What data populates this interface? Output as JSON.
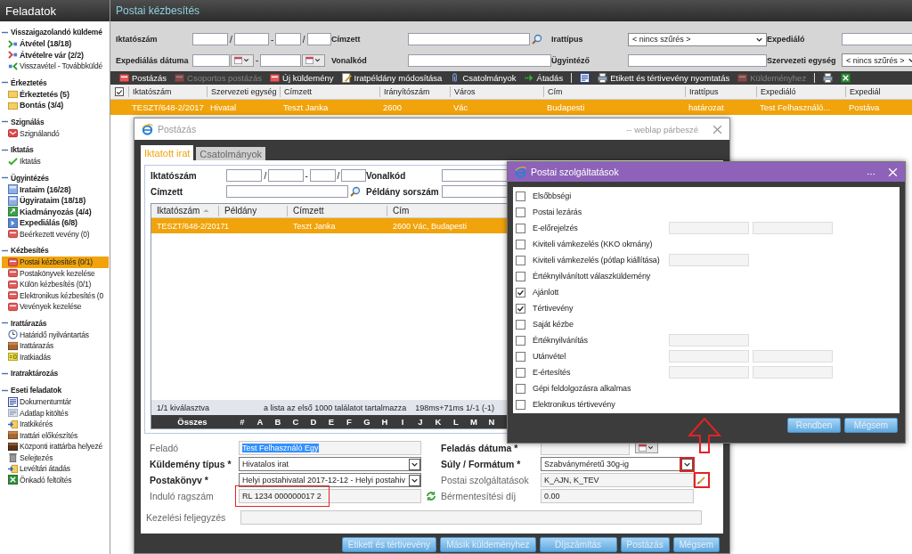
{
  "sidebar": {
    "title": "Feladatok",
    "groups": [
      {
        "label": "Visszaigazolandó küldemé",
        "expanded": true,
        "items": [
          {
            "label": "Átvétel (18/18)",
            "kind": "chevron-green",
            "bold": true,
            "selected": false
          },
          {
            "label": "Átvételre vár (2/2)",
            "kind": "chevron-red",
            "bold": true,
            "selected": false
          },
          {
            "label": "Visszavétel - Továbbküldé",
            "kind": "chevron-back",
            "bold": false,
            "selected": false
          }
        ]
      },
      {
        "label": "Érkeztetés",
        "expanded": true,
        "items": [
          {
            "label": "Érkeztetés (5)",
            "kind": "folder",
            "bold": true,
            "selected": false
          },
          {
            "label": "Bontás (3/4)",
            "kind": "folder",
            "bold": true,
            "selected": false
          }
        ]
      },
      {
        "label": "Szignálás",
        "expanded": true,
        "items": [
          {
            "label": "Szignálandó",
            "kind": "envelope",
            "bold": false,
            "selected": false
          }
        ]
      },
      {
        "label": "Iktatás",
        "expanded": true,
        "items": [
          {
            "label": "Iktatás",
            "kind": "check",
            "bold": false,
            "selected": false
          }
        ]
      },
      {
        "label": "Ügyintézés",
        "expanded": true,
        "items": [
          {
            "label": "Irataim (16/28)",
            "kind": "doc-blue",
            "bold": true,
            "selected": false
          },
          {
            "label": "Ügyirataim (18/18)",
            "kind": "doc-blue",
            "bold": true,
            "selected": false
          },
          {
            "label": "Kiadmányozás (4/4)",
            "kind": "doc-green",
            "bold": true,
            "selected": false
          },
          {
            "label": "Expediálás (6/8)",
            "kind": "doc-send",
            "bold": true,
            "selected": false
          },
          {
            "label": "Beérkezett vevény (0)",
            "kind": "red-box",
            "bold": false,
            "selected": false
          }
        ]
      },
      {
        "label": "Kézbesítés",
        "expanded": true,
        "items": [
          {
            "label": "Postai kézbesítés (0/1)",
            "kind": "red-box",
            "bold": false,
            "selected": true
          },
          {
            "label": "Postakönyvek kezelése",
            "kind": "red-box",
            "bold": false,
            "selected": false
          },
          {
            "label": "Külön kézbesítés (0/1)",
            "kind": "red-box",
            "bold": false,
            "selected": false
          },
          {
            "label": "Elektronikus kézbesítés (0",
            "kind": "red-box",
            "bold": false,
            "selected": false
          },
          {
            "label": "Vevények kezelése",
            "kind": "red-box",
            "bold": false,
            "selected": false
          }
        ]
      },
      {
        "label": "Irattárazás",
        "expanded": true,
        "items": [
          {
            "label": "Határidő nyilvántartás",
            "kind": "clock",
            "bold": false,
            "selected": false
          },
          {
            "label": "Irattárazás",
            "kind": "brown-box",
            "bold": false,
            "selected": false
          },
          {
            "label": "Iratkiadás",
            "kind": "yellow-card",
            "bold": false,
            "selected": false
          }
        ]
      },
      {
        "label": "Iratraktározás",
        "expanded": true
      },
      {
        "label": "Eseti feladatok",
        "expanded": true,
        "items": [
          {
            "label": "Dokumentumtár",
            "kind": "word",
            "bold": false,
            "selected": false
          },
          {
            "label": "Adatlap kitöltés",
            "kind": "form",
            "bold": false,
            "selected": false
          },
          {
            "label": "Iratkikérés",
            "kind": "arrow-yellow",
            "bold": false,
            "selected": false
          },
          {
            "label": "Irattári előkészítés",
            "kind": "brown-box",
            "bold": false,
            "selected": false
          },
          {
            "label": "Központi irattárba helyezé",
            "kind": "dark-box",
            "bold": false,
            "selected": false
          },
          {
            "label": "Selejtezés",
            "kind": "trash",
            "bold": false,
            "selected": false
          },
          {
            "label": "Levéltári átadás",
            "kind": "arrow-yellow",
            "bold": false,
            "selected": false
          },
          {
            "label": "Önkadó feltöltés",
            "kind": "excel",
            "bold": false,
            "selected": false
          }
        ]
      }
    ]
  },
  "main": {
    "title": "Postai kézbesítés",
    "filters": [
      {
        "label": "Iktatószám",
        "kind": "number",
        "separators": [
          "/",
          "-",
          "/"
        ]
      },
      {
        "label": "Címzett",
        "kind": "search"
      },
      {
        "label": "Irattípus",
        "kind": "select",
        "value": "< nincs szűrés >"
      },
      {
        "label": "Expediáló",
        "kind": "text"
      },
      {
        "label": "Expediálás dátuma",
        "kind": "daterange",
        "separator": "-"
      },
      {
        "label": "Vonalkód",
        "kind": "text"
      },
      {
        "label": "Ügyintéző",
        "kind": "text"
      },
      {
        "label": "Szervezeti egység",
        "kind": "select",
        "value": "< nincs szűrés >"
      }
    ],
    "toolbar": [
      {
        "label": "Postázás",
        "kind": "red-doc",
        "disabled": false
      },
      {
        "label": "Csoportos postázás",
        "kind": "red-doc",
        "disabled": true
      },
      {
        "label": "Új küldemény",
        "kind": "red-doc",
        "disabled": false
      },
      {
        "label": "Iratpéldány módosítása",
        "kind": "edit",
        "disabled": false
      },
      {
        "label": "Csatolmányok",
        "kind": "clip",
        "disabled": false
      },
      {
        "label": "Átadás",
        "kind": "forward",
        "disabled": false
      },
      {
        "kind": "separator"
      },
      {
        "kind": "word",
        "disabled": false
      },
      {
        "label": "Etikett és tértivevény nyomtatás",
        "kind": "print",
        "disabled": false
      },
      {
        "label": "Küldeményhez",
        "kind": "red-doc",
        "disabled": true
      },
      {
        "kind": "separator"
      },
      {
        "kind": "print",
        "disabled": false
      },
      {
        "kind": "excel",
        "disabled": false
      }
    ],
    "table": {
      "checked": true,
      "columns": [
        "Iktatószám",
        "Szervezeti egység",
        "Címzett",
        "Irányítószám",
        "Város",
        "Cím",
        "Irattípus",
        "Expediáló",
        "Expediál"
      ],
      "rows": [
        {
          "selected": true,
          "cells": [
            "TESZT/648-2/2017",
            "Hivatal",
            "Teszt Janka",
            "2600",
            "Vác",
            "Budapesti",
            "határozat",
            "Test Felhasználó...",
            "Postáva"
          ]
        }
      ]
    }
  },
  "postazas": {
    "title": "Postázás",
    "subtitle": "-- weblap párbeszé",
    "tabs": [
      {
        "label": "Iktatott irat",
        "selected": true
      },
      {
        "label": "Csatolmányok",
        "selected": false
      }
    ],
    "filters": [
      {
        "label": "Iktatószám",
        "kind": "number",
        "separators": [
          "/",
          "-",
          "/"
        ]
      },
      {
        "label": "Vonalkód",
        "kind": "text"
      },
      {
        "label": "Címzett",
        "kind": "search"
      },
      {
        "label": "Példány sorszám",
        "kind": "text"
      }
    ],
    "table": {
      "columns": [
        {
          "label": "Iktatószám",
          "sorted": true
        },
        {
          "label": "Példány",
          "sorted": false
        },
        {
          "label": "Címzett",
          "sorted": false
        },
        {
          "label": "Cím",
          "sorted": false
        }
      ],
      "rows": [
        {
          "selected": true,
          "cells": [
            "TESZT/648-2/2017",
            "1",
            "Teszt Janka",
            "2600 Vác, Budapesti"
          ]
        }
      ],
      "footer": [
        "1/1 kiválasztva",
        "a lista az első 1000 találatot tartalmazza",
        "198ms+71ms 1/-1 (-1)"
      ],
      "alphabet": {
        "all": "Összes",
        "letters": [
          "#",
          "A",
          "B",
          "C",
          "D",
          "E",
          "F",
          "G",
          "H",
          "I",
          "J",
          "K",
          "L",
          "M",
          "N"
        ]
      }
    },
    "form_left": [
      {
        "label": "Feladó",
        "required": false,
        "kind": "text",
        "value": "Test Felhasználó Egy",
        "highlighted": true,
        "annotated": false
      },
      {
        "label": "Küldemény típus *",
        "required": true,
        "kind": "select",
        "value": "Hivatalos irat",
        "annotated": false
      },
      {
        "label": "Postakönyv *",
        "required": true,
        "kind": "select",
        "value": "Helyi postahivatal 2017-12-12 - Helyi postahiv",
        "annotated": false
      },
      {
        "label": "Induló ragszám",
        "required": false,
        "kind": "refresh",
        "value": "RL 1234 000000017 2",
        "annotated": true
      }
    ],
    "form_right": [
      {
        "label": "Feladás dátuma *",
        "required": true,
        "kind": "date",
        "annotated": false
      },
      {
        "label": "Súly / Formátum *",
        "required": true,
        "kind": "select",
        "value": "Szabványméretű 30g-ig",
        "annotated": true
      },
      {
        "label": "Postai szolgáltatások",
        "required": false,
        "kind": "edit",
        "value": "K_AJN, K_TEV",
        "annotated": true
      },
      {
        "label": "Bérmentesítési díj",
        "required": false,
        "kind": "text",
        "value": "0.00",
        "annotated": false
      }
    ],
    "note": {
      "label": "Kezelési feljegyzés"
    },
    "buttons": [
      "Etikett és tértivevény",
      "Másik küldeményhez",
      "Díjszámítás",
      "Postázás",
      "Mégsem"
    ]
  },
  "services": {
    "title": "Postai szolgáltatások",
    "options": [
      {
        "label": "Elsőbbségi",
        "checked": false,
        "kind": "plain"
      },
      {
        "label": "Postai lezárás",
        "checked": false,
        "kind": "plain"
      },
      {
        "label": "E-előrejelzés",
        "checked": false,
        "kind": "two-fields"
      },
      {
        "label": "Kiviteli vámkezelés (KKO okmány)",
        "checked": false,
        "kind": "plain"
      },
      {
        "label": "Kiviteli vámkezelés (pótlap kiállítása)",
        "checked": false,
        "kind": "one-field"
      },
      {
        "label": "Értéknyilvánított válaszküldemény",
        "checked": false,
        "kind": "plain"
      },
      {
        "label": "Ajánlott",
        "checked": true,
        "kind": "plain"
      },
      {
        "label": "Tértivevény",
        "checked": true,
        "kind": "plain"
      },
      {
        "label": "Saját kézbe",
        "checked": false,
        "kind": "plain"
      },
      {
        "label": "Értéknyilvánítás",
        "checked": false,
        "kind": "one-field"
      },
      {
        "label": "Utánvétel",
        "checked": false,
        "kind": "two-fields"
      },
      {
        "label": "E-értesítés",
        "checked": false,
        "kind": "two-fields"
      },
      {
        "label": "Gépi feldolgozásra alkalmas",
        "checked": false,
        "kind": "plain"
      },
      {
        "label": "Elektronikus tértivevény",
        "checked": false,
        "kind": "plain"
      }
    ],
    "buttons": [
      "Rendben",
      "Mégsem"
    ]
  }
}
